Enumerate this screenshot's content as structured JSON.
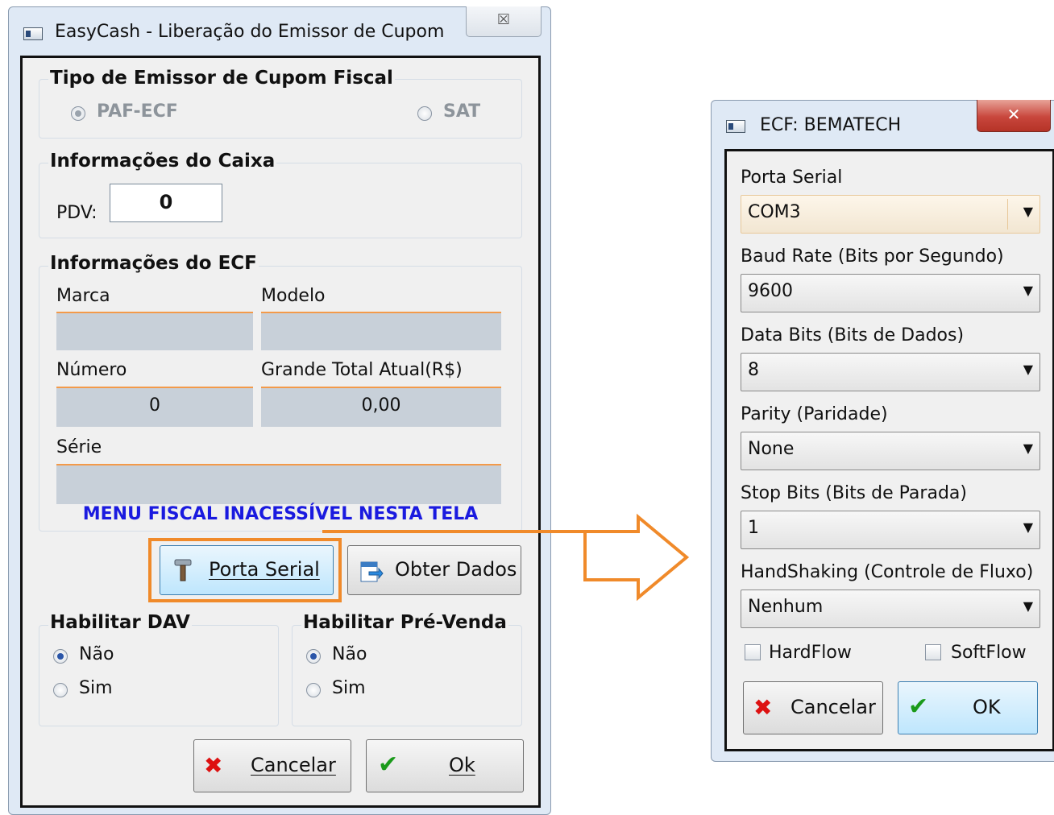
{
  "main_window": {
    "title": "EasyCash - Liberação do Emissor de Cupom",
    "close_glyph": "☒",
    "tipo": {
      "title": "Tipo de Emissor de Cupom Fiscal",
      "options": [
        "PAF-ECF",
        "SAT"
      ],
      "selected": "PAF-ECF"
    },
    "caixa": {
      "title": "Informações do Caixa",
      "pdv_label": "PDV:",
      "pdv_value": "0"
    },
    "ecf": {
      "title": "Informações do ECF",
      "marca_label": "Marca",
      "marca_value": "",
      "modelo_label": "Modelo",
      "modelo_value": "",
      "numero_label": "Número",
      "numero_value": "0",
      "grande_total_label": "Grande Total Atual(R$)",
      "grande_total_value": "0,00",
      "serie_label": "Série",
      "serie_value": "",
      "menu_warning": "MENU FISCAL INACESSÍVEL NESTA TELA"
    },
    "buttons": {
      "porta_serial": "Porta Serial",
      "obter_dados": "Obter Dados",
      "cancelar": "Cancelar",
      "ok": "Ok"
    },
    "dav": {
      "title": "Habilitar DAV",
      "options": [
        "Não",
        "Sim"
      ],
      "selected": "Não"
    },
    "pre_venda": {
      "title": "Habilitar Pré-Venda",
      "options": [
        "Não",
        "Sim"
      ],
      "selected": "Não"
    }
  },
  "ecf_window": {
    "title": "ECF: BEMATECH",
    "close_glyph": "✕",
    "porta_serial": {
      "label": "Porta Serial",
      "value": "COM3"
    },
    "baud_rate": {
      "label": "Baud Rate (Bits por Segundo)",
      "value": "9600"
    },
    "data_bits": {
      "label": "Data Bits (Bits de Dados)",
      "value": "8"
    },
    "parity": {
      "label": "Parity (Paridade)",
      "value": "None"
    },
    "stop_bits": {
      "label": "Stop Bits (Bits de Parada)",
      "value": "1"
    },
    "handshaking": {
      "label": "HandShaking (Controle de Fluxo)",
      "value": "Nenhum"
    },
    "hardflow": {
      "label": "HardFlow",
      "checked": false
    },
    "softflow": {
      "label": "SoftFlow",
      "checked": false
    },
    "cancelar": "Cancelar",
    "ok": "OK"
  },
  "colors": {
    "highlight_orange": "#f08a2a",
    "warning_blue": "#1a1adf",
    "cancel_red": "#dd1111",
    "ok_green": "#1a9a1a",
    "close_red": "#c8463c"
  },
  "icons": {
    "window_icon": "app-window-icon",
    "porta_serial_icon": "hammer-icon",
    "obter_dados_icon": "document-arrow-icon",
    "cancel_icon": "x-icon",
    "ok_icon": "checkmark-icon",
    "combo_arrow": "chevron-down-icon"
  }
}
